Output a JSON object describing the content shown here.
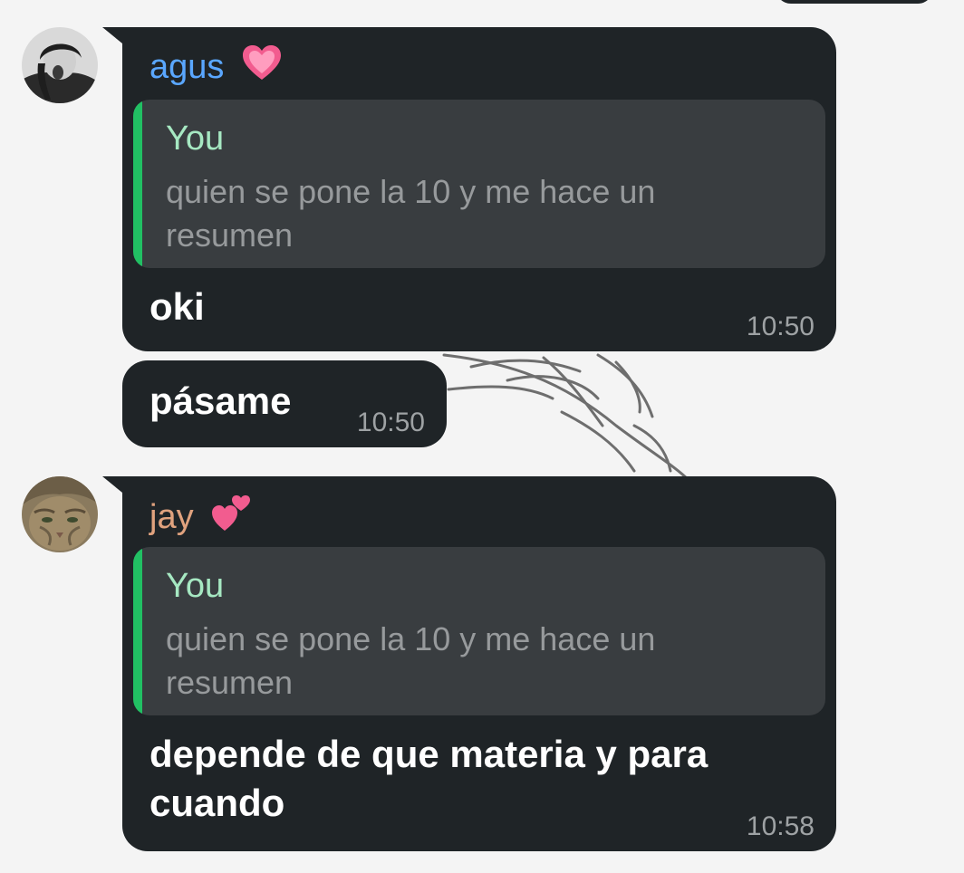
{
  "messages": [
    {
      "sender": "agus",
      "sender_color": "#5aa7ff",
      "sender_emoji": "pink-heart",
      "avatar": "user-photo-avatar",
      "reply_to": {
        "author": "You",
        "text": "quien se pone la 10 y me hace un resumen"
      },
      "text": "oki",
      "time": "10:50"
    },
    {
      "text": "pásame",
      "time": "10:50"
    },
    {
      "sender": "jay",
      "sender_color": "#e0a27e",
      "sender_emoji": "two-hearts",
      "avatar": "cat-photo-avatar",
      "reply_to": {
        "author": "You",
        "text": "quien se pone la 10 y me hace un resumen"
      },
      "text": "depende de que materia y para cuando",
      "time": "10:58"
    }
  ],
  "colors": {
    "bubble": "#1f2427",
    "quote_bg": "#393d40",
    "quote_bar": "#21c063",
    "quote_author": "#a6e8c2",
    "quote_text": "#979a9c",
    "time": "#9ea2a4",
    "background": "#f4f4f4"
  }
}
